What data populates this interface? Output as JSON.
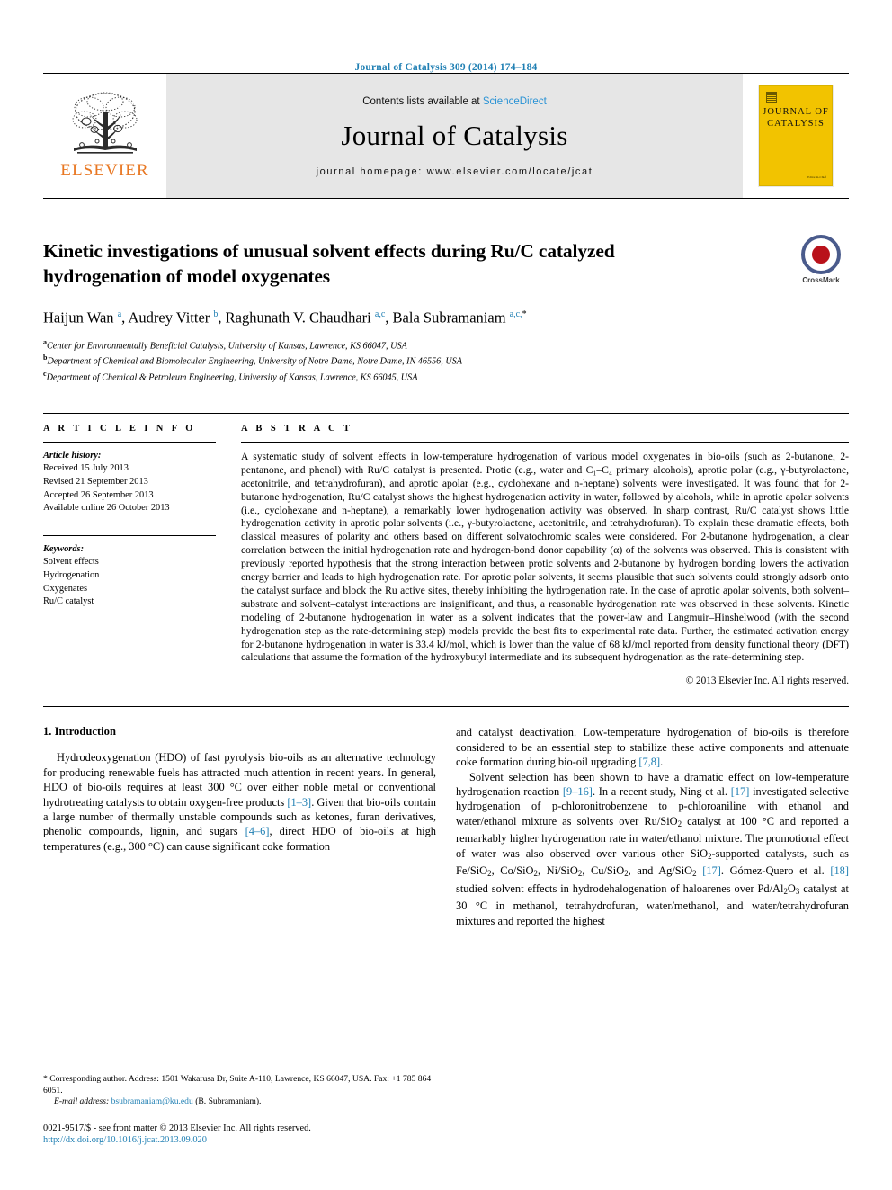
{
  "running_head": "Journal of Catalysis 309 (2014) 174–184",
  "masthead": {
    "publisher_name": "ELSEVIER",
    "publisher_logo_icon": "elsevier-tree-icon",
    "contents_prefix": "Contents lists available at ",
    "contents_link": "ScienceDirect",
    "journal_name": "Journal of Catalysis",
    "homepage": "journal homepage: www.elsevier.com/locate/jcat",
    "cover": {
      "line1": "JOURNAL OF",
      "line2": "CATALYSIS",
      "footnote": "Editor-in-Chief"
    },
    "accent_color": "#2a93d5",
    "elsevier_orange": "#E87722",
    "cover_yellow": "#F2C300"
  },
  "article": {
    "title": "Kinetic investigations of unusual solvent effects during Ru/C catalyzed hydrogenation of model oxygenates",
    "crossmark_label": "CrossMark",
    "authors_html": "Haijun Wan <sup>a</sup>, Audrey Vitter <sup>b</sup>, Raghunath V. Chaudhari <sup>a,c</sup>, Bala Subramaniam <sup>a,c,</sup><sup class=\"star\">*</sup>",
    "affiliations": [
      {
        "mark": "a",
        "text": "Center for Environmentally Beneficial Catalysis, University of Kansas, Lawrence, KS 66047, USA"
      },
      {
        "mark": "b",
        "text": "Department of Chemical and Biomolecular Engineering, University of Notre Dame, Notre Dame, IN 46556, USA"
      },
      {
        "mark": "c",
        "text": "Department of Chemical & Petroleum Engineering, University of Kansas, Lawrence, KS 66045, USA"
      }
    ]
  },
  "article_info": {
    "heading": "A R T I C L E    I N F O",
    "history_label": "Article history:",
    "history": [
      "Received 15 July 2013",
      "Revised 21 September 2013",
      "Accepted 26 September 2013",
      "Available online 26 October 2013"
    ],
    "keywords_label": "Keywords:",
    "keywords": [
      "Solvent effects",
      "Hydrogenation",
      "Oxygenates",
      "Ru/C catalyst"
    ]
  },
  "abstract": {
    "heading": "A B S T R A C T",
    "text": "A systematic study of solvent effects in low-temperature hydrogenation of various model oxygenates in bio-oils (such as 2-butanone, 2-pentanone, and phenol) with Ru/C catalyst is presented. Protic (e.g., water and C₁–C₄ primary alcohols), aprotic polar (e.g., γ-butyrolactone, acetonitrile, and tetrahydrofuran), and aprotic apolar (e.g., cyclohexane and n-heptane) solvents were investigated. It was found that for 2-butanone hydrogenation, Ru/C catalyst shows the highest hydrogenation activity in water, followed by alcohols, while in aprotic apolar solvents (i.e., cyclohexane and n-heptane), a remarkably lower hydrogenation activity was observed. In sharp contrast, Ru/C catalyst shows little hydrogenation activity in aprotic polar solvents (i.e., γ-butyrolactone, acetonitrile, and tetrahydrofuran). To explain these dramatic effects, both classical measures of polarity and others based on different solvatochromic scales were considered. For 2-butanone hydrogenation, a clear correlation between the initial hydrogenation rate and hydrogen-bond donor capability (α) of the solvents was observed. This is consistent with previously reported hypothesis that the strong interaction between protic solvents and 2-butanone by hydrogen bonding lowers the activation energy barrier and leads to high hydrogenation rate. For aprotic polar solvents, it seems plausible that such solvents could strongly adsorb onto the catalyst surface and block the Ru active sites, thereby inhibiting the hydrogenation rate. In the case of aprotic apolar solvents, both solvent–substrate and solvent–catalyst interactions are insignificant, and thus, a reasonable hydrogenation rate was observed in these solvents. Kinetic modeling of 2-butanone hydrogenation in water as a solvent indicates that the power-law and Langmuir–Hinshelwood (with the second hydrogenation step as the rate-determining step) models provide the best fits to experimental rate data. Further, the estimated activation energy for 2-butanone hydrogenation in water is 33.4 kJ/mol, which is lower than the value of 68 kJ/mol reported from density functional theory (DFT) calculations that assume the formation of the hydroxybutyl intermediate and its subsequent hydrogenation as the rate-determining step.",
    "copyright": "© 2013 Elsevier Inc. All rights reserved."
  },
  "introduction": {
    "section_title": "1. Introduction",
    "left_para_1_html": "Hydrodeoxygenation (HDO) of fast pyrolysis bio-oils as an alternative technology for producing renewable fuels has attracted much attention in recent years. In general, HDO of bio-oils requires at least 300 °C over either noble metal or conventional hydrotreating catalysts to obtain oxygen-free products <span class=\"lnk\">[1–3]</span>. Given that bio-oils contain a large number of thermally unstable compounds such as ketones, furan derivatives, phenolic compounds, lignin, and sugars <span class=\"lnk\">[4–6]</span>, direct HDO of bio-oils at high temperatures (e.g., 300 °C) can cause significant coke formation",
    "right_para_1_html": "and catalyst deactivation. Low-temperature hydrogenation of bio-oils is therefore considered to be an essential step to stabilize these active components and attenuate coke formation during bio-oil upgrading <span class=\"lnk\">[7,8]</span>.",
    "right_para_2_html": "Solvent selection has been shown to have a dramatic effect on low-temperature hydrogenation reaction <span class=\"lnk\">[9–16]</span>. In a recent study, Ning et al. <span class=\"lnk\">[17]</span> investigated selective hydrogenation of p-chloronitrobenzene to p-chloroaniline with ethanol and water/ethanol mixture as solvents over Ru/SiO<sub>2</sub> catalyst at 100 °C and reported a remarkably higher hydrogenation rate in water/ethanol mixture. The promotional effect of water was also observed over various other SiO<sub>2</sub>-supported catalysts, such as Fe/SiO<sub>2</sub>, Co/SiO<sub>2</sub>, Ni/SiO<sub>2</sub>, Cu/SiO<sub>2</sub>, and Ag/SiO<sub>2</sub> <span class=\"lnk\">[17]</span>. Gómez-Quero et al. <span class=\"lnk\">[18]</span> studied solvent effects in hydrodehalogenation of haloarenes over Pd/Al<sub>2</sub>O<sub>3</sub> catalyst at 30 °C in methanol, tetrahydrofuran, water/methanol, and water/tetrahydrofuran mixtures and reported the highest"
  },
  "footnotes": {
    "corresponding_html": "* Corresponding author. Address: 1501 Wakarusa Dr, Suite A-110, Lawrence, KS 66047, USA. Fax: +1 785 864 6051.",
    "email_label": "E-mail address:",
    "email": "bsubramaniam@ku.edu",
    "email_owner": "(B. Subramaniam)."
  },
  "footer": {
    "issn_line": "0021-9517/$ - see front matter © 2013 Elsevier Inc. All rights reserved.",
    "doi": "http://dx.doi.org/10.1016/j.jcat.2013.09.020",
    "link_color": "#1f7fb3"
  }
}
